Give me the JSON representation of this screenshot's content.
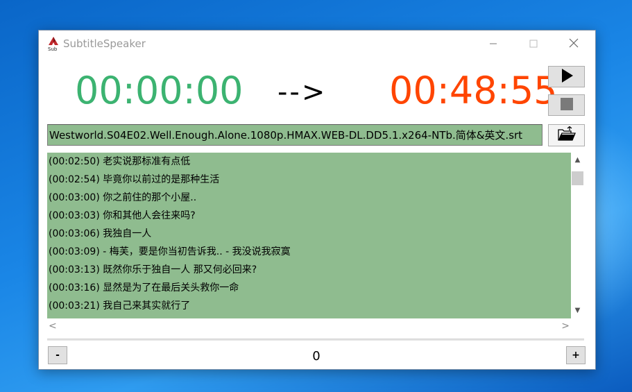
{
  "window": {
    "title": "SubtitleSpeaker",
    "controls": [
      "minimize-icon",
      "maximize-icon",
      "close-icon"
    ]
  },
  "timer": {
    "start": "00:00:00",
    "arrow": "-->",
    "end": "00:48:55",
    "start_color": "#3cb371",
    "end_color": "#ff4500"
  },
  "buttons": {
    "play_icon": "play-icon",
    "stop_icon": "stop-icon",
    "open_icon": "open-folder-icon",
    "minus_label": "-",
    "plus_label": "+"
  },
  "file": {
    "name": "Westworld.S04E02.Well.Enough.Alone.1080p.HMAX.WEB-DL.DD5.1.x264-NTb.简体&英文.srt"
  },
  "subtitles": [
    {
      "time": "(00:02:50)",
      "text": "老实说那标准有点低"
    },
    {
      "time": "(00:02:54)",
      "text": "毕竟你以前过的是那种生活"
    },
    {
      "time": "(00:03:00)",
      "text": "你之前住的那个小屋.."
    },
    {
      "time": "(00:03:03)",
      "text": "你和其他人会往来吗?"
    },
    {
      "time": "(00:03:06)",
      "text": "我独自一人"
    },
    {
      "time": "(00:03:09)",
      "text": " - 梅芙，要是你当初告诉我.. - 我没说我寂寞"
    },
    {
      "time": "(00:03:13)",
      "text": "既然你乐于独自一人 那又何必回来?"
    },
    {
      "time": "(00:03:16)",
      "text": "显然是为了在最后关头救你一命"
    },
    {
      "time": "(00:03:21)",
      "text": "我自己来其实就行了"
    }
  ],
  "counter": {
    "value": "0"
  },
  "colors": {
    "list_background": "#8fbc8f",
    "window_background": "#ffffff"
  }
}
